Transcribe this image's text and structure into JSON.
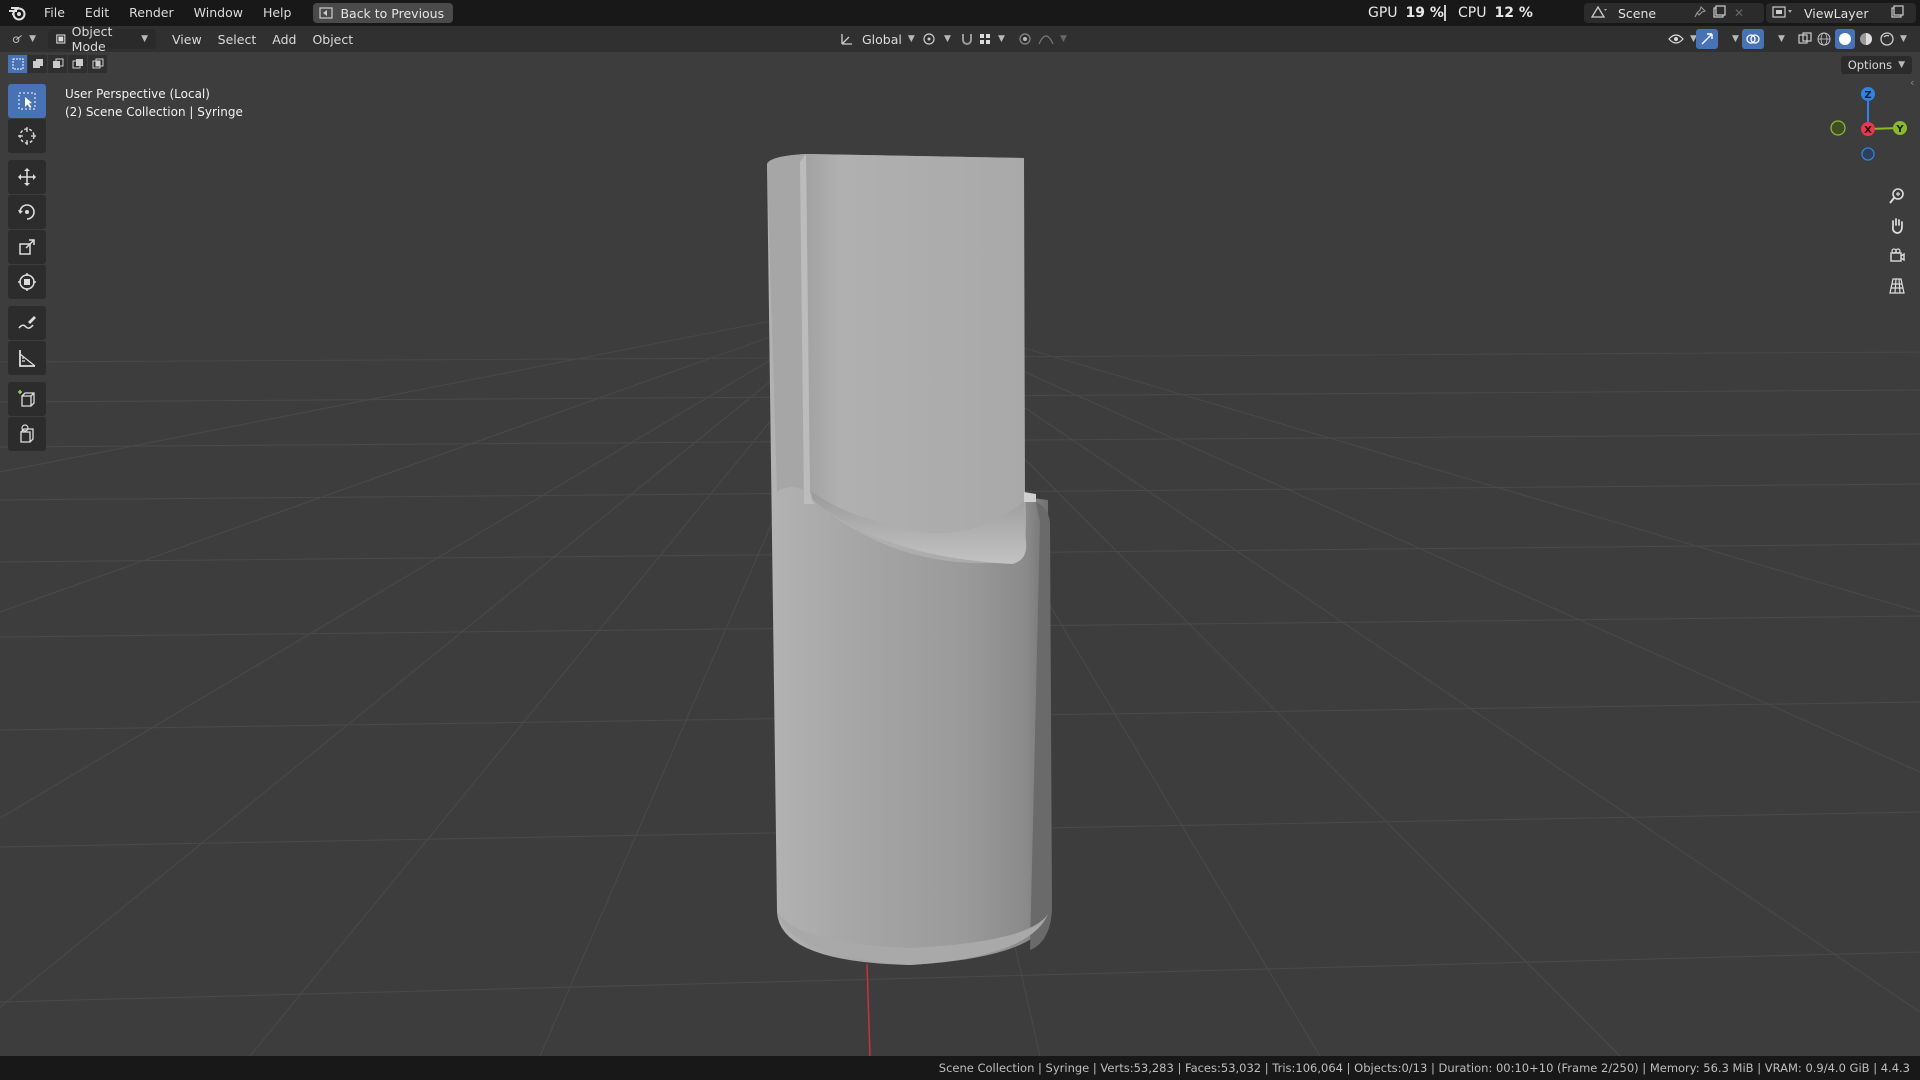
{
  "topbar": {
    "menus": [
      "File",
      "Edit",
      "Render",
      "Window",
      "Help"
    ],
    "back_button": "Back to Previous",
    "gpu_label": "GPU",
    "gpu_value": "19 %",
    "cpu_label": "CPU",
    "cpu_value": "12 %",
    "scene_name": "Scene",
    "view_layer": "ViewLayer"
  },
  "header": {
    "mode": "Object Mode",
    "menus": [
      "View",
      "Select",
      "Add",
      "Object"
    ],
    "orientation": "Global",
    "options_label": "Options"
  },
  "viewport": {
    "perspective_label": "User Perspective (Local)",
    "collection_label": "(2) Scene Collection | Syringe"
  },
  "gizmo": {
    "z_label": "Z",
    "x_label": "X",
    "y_label": "Y",
    "colors": {
      "x": "#e8384f",
      "y": "#8bb82d",
      "z": "#2f83e3"
    }
  },
  "statusbar": {
    "text": "Scene Collection | Syringe | Verts:53,283 | Faces:53,032 | Tris:106,064 | Objects:0/13 | Duration: 00:10+10 (Frame 2/250) | Memory: 56.3 MiB | VRAM: 0.9/4.0 GiB | 4.4.3"
  },
  "colors": {
    "accent": "#4772b3",
    "viewport_bg": "#3d3d3d",
    "axis_red": "#c7343c"
  }
}
